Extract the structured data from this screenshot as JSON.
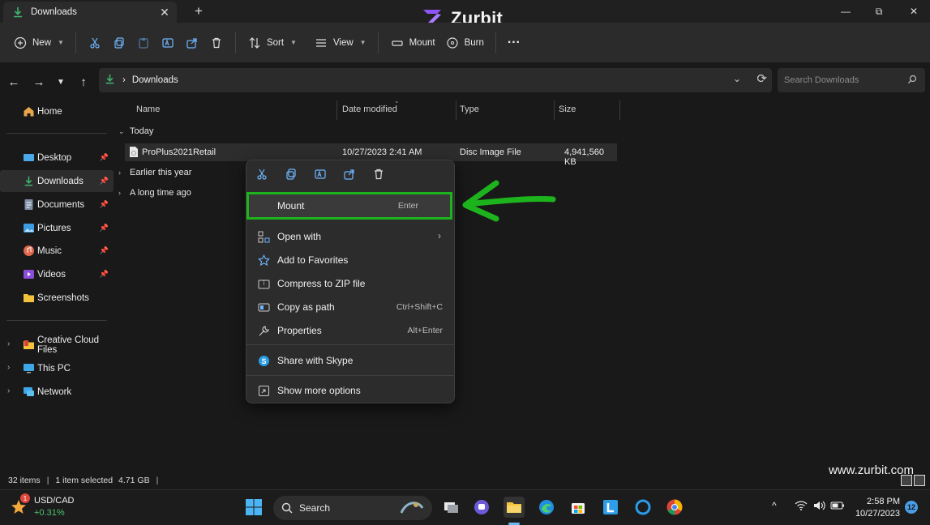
{
  "tab": {
    "label": "Downloads",
    "close": "✕",
    "new_tab": "+"
  },
  "brand": {
    "name": "Zurbit"
  },
  "window_controls": {
    "minimize": "—",
    "maximize": "⧉",
    "close": "✕"
  },
  "toolbar": {
    "new_label": "New",
    "sort_label": "Sort",
    "view_label": "View",
    "mount_label": "Mount",
    "burn_label": "Burn",
    "more_label": "···"
  },
  "address": {
    "path": "Downloads",
    "separator": "›",
    "search_placeholder": "Search Downloads"
  },
  "sidebar": {
    "items": [
      {
        "label": "Home"
      },
      {
        "label": "Desktop"
      },
      {
        "label": "Downloads"
      },
      {
        "label": "Documents"
      },
      {
        "label": "Pictures"
      },
      {
        "label": "Music"
      },
      {
        "label": "Videos"
      },
      {
        "label": "Screenshots"
      },
      {
        "label": "Creative Cloud Files"
      },
      {
        "label": "This PC"
      },
      {
        "label": "Network"
      }
    ]
  },
  "columns": {
    "name": "Name",
    "date": "Date modified",
    "type": "Type",
    "size": "Size"
  },
  "groups": {
    "today": "Today",
    "earlier": "Earlier this year",
    "long_ago": "A long time ago"
  },
  "file": {
    "name": "ProPlus2021Retail",
    "date": "10/27/2023 2:41 AM",
    "type": "Disc Image File",
    "size": "4,941,560 KB"
  },
  "context_menu": {
    "items": [
      {
        "label": "Mount",
        "shortcut": "Enter"
      },
      {
        "label": "Open with",
        "shortcut": "›"
      },
      {
        "label": "Add to Favorites",
        "shortcut": ""
      },
      {
        "label": "Compress to ZIP file",
        "shortcut": ""
      },
      {
        "label": "Copy as path",
        "shortcut": "Ctrl+Shift+C"
      },
      {
        "label": "Properties",
        "shortcut": "Alt+Enter"
      },
      {
        "label": "Share with Skype",
        "shortcut": ""
      },
      {
        "label": "Show more options",
        "shortcut": ""
      }
    ]
  },
  "status": {
    "items": "32 items",
    "selected": "1 item selected",
    "size": "4.71 GB",
    "separator": "|"
  },
  "watermark": "www.zurbit.com",
  "taskbar": {
    "weather_ticker": "USD/CAD",
    "weather_change": "+0.31%",
    "weather_badge": "1",
    "search_label": "Search",
    "time": "2:58 PM",
    "date": "10/27/2023",
    "notif_count": "12"
  },
  "colors": {
    "highlight_green": "#1db31d",
    "accent_purple": "#7b3ff2",
    "folder_yellow": "#f3c33c"
  }
}
